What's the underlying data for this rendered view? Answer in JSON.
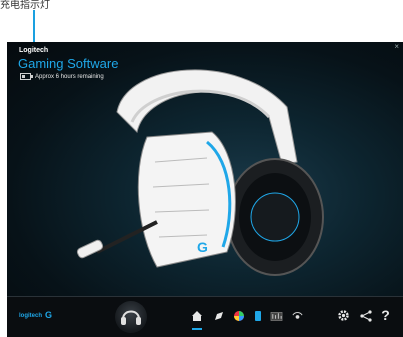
{
  "annotation": {
    "label": "充电指示灯",
    "line_color": "#1aa0e0"
  },
  "app": {
    "brand": "Logitech",
    "title": "Gaming Software",
    "battery_text": "Approx 6 hours remaining",
    "battery_level": 0.4,
    "close_symbol": "×",
    "accent_color": "#1fa7e8"
  },
  "bottombar": {
    "logo_text": "logitech",
    "logo_mark": "G",
    "tools": [
      {
        "name": "home-icon"
      },
      {
        "name": "customize-icon"
      },
      {
        "name": "lighting-icon"
      },
      {
        "name": "battery-status-icon"
      },
      {
        "name": "equalizer-icon"
      },
      {
        "name": "surround-sound-icon"
      },
      {
        "name": "settings-gear-icon"
      },
      {
        "name": "share-icon"
      },
      {
        "name": "help-icon"
      }
    ],
    "help_symbol": "?"
  }
}
